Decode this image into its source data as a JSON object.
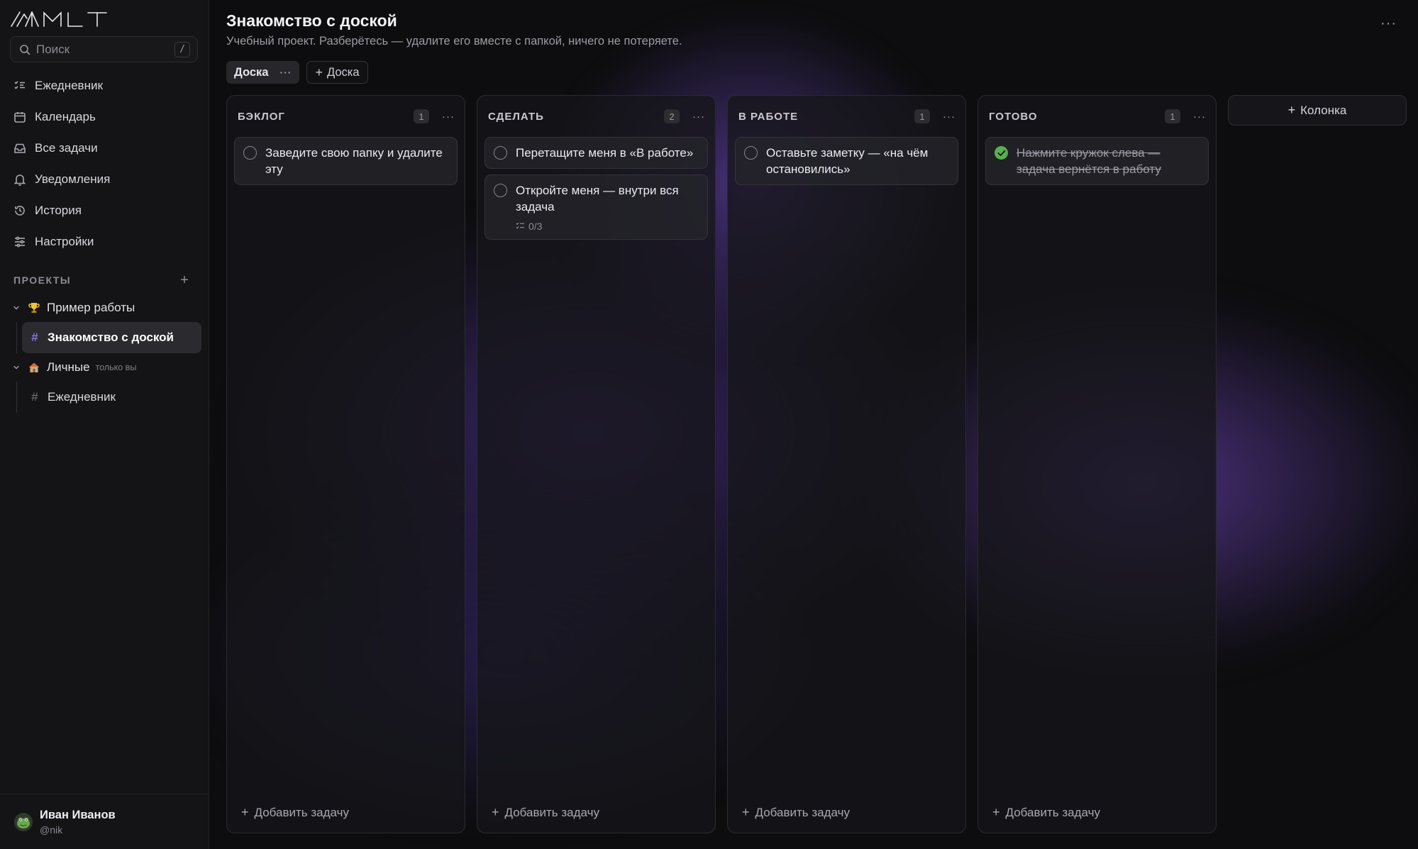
{
  "app": {
    "logo_text": "MLT"
  },
  "search": {
    "placeholder": "Поиск",
    "shortcut": "/"
  },
  "nav": {
    "items": [
      {
        "label": "Ежедневник",
        "icon": "list-check-icon"
      },
      {
        "label": "Календарь",
        "icon": "calendar-icon"
      },
      {
        "label": "Все задачи",
        "icon": "inbox-icon"
      },
      {
        "label": "Уведомления",
        "icon": "bell-icon"
      },
      {
        "label": "История",
        "icon": "history-icon"
      },
      {
        "label": "Настройки",
        "icon": "sliders-icon"
      }
    ]
  },
  "projects": {
    "label": "ПРОЕКТЫ",
    "add": "+",
    "groups": [
      {
        "name": "Пример работы",
        "icon": "trophy-icon",
        "boards": [
          "Знакомство с доской"
        ]
      },
      {
        "name": "Личные",
        "tag": "только вы",
        "icon": "house-icon",
        "boards": [
          "Ежедневник"
        ]
      }
    ]
  },
  "user": {
    "name": "Иван Иванов",
    "handle": "@nik"
  },
  "page": {
    "title": "Знакомство с доской",
    "subtitle": "Учебный проект. Разберётесь — удалите его вместе с папкой, ничего не потеряете.",
    "more": "···"
  },
  "tabs": {
    "active": "Доска",
    "more": "···",
    "add": "Доска",
    "add_prefix": "+"
  },
  "board": {
    "add_task": "Добавить задачу",
    "add_column": "Колонка",
    "columns": [
      {
        "title": "БЭКЛОГ",
        "count": "1",
        "cards": [
          {
            "text": "Заведите свою папку и удалите эту",
            "done": false
          }
        ]
      },
      {
        "title": "СДЕЛАТЬ",
        "count": "2",
        "cards": [
          {
            "text": "Перетащите меня в «В работе»",
            "done": false
          },
          {
            "text": "Откройте меня — внутри вся задача",
            "done": false,
            "subtasks": "0/3"
          }
        ]
      },
      {
        "title": "В РАБОТЕ",
        "count": "1",
        "cards": [
          {
            "text": "Оставьте заметку — «на чём остановились»",
            "done": false
          }
        ]
      },
      {
        "title": "ГОТОВО",
        "count": "1",
        "cards": [
          {
            "text": "Нажмите кружок слева — задача вернётся в работу",
            "done": true
          }
        ]
      }
    ]
  },
  "colors": {
    "background": "#0d0d0f",
    "accent": "#8c76d8",
    "done": "#58b04e",
    "glow": "#7a50d2"
  }
}
